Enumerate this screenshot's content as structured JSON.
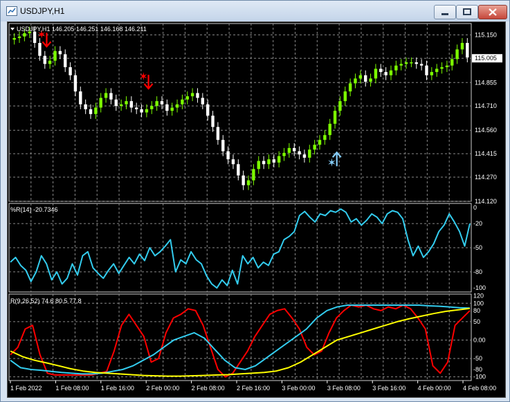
{
  "window": {
    "title": "USDJPY,H1"
  },
  "main_pane": {
    "header": "USDJPY,H1  146.205 146.251 146.168 146.211",
    "price_labels": [
      "115.150",
      "115.005",
      "114.855",
      "114.710",
      "114.560",
      "114.415",
      "114.270",
      "114.120"
    ],
    "current_price_label": "115.005"
  },
  "wpr_pane": {
    "header": "%R(14) -20.7346",
    "scale_labels": [
      "0",
      "-20",
      "-50",
      "-80",
      "-100"
    ]
  },
  "rsi_pane": {
    "header": "R(9,26,52) 74.6 80.5 77.8",
    "scale_labels": [
      "120",
      "100",
      "80",
      "50",
      "0.00",
      "-50",
      "-80",
      "-100"
    ]
  },
  "time_labels": [
    "1 Feb 2022",
    "1 Feb 08:00",
    "1 Feb 16:00",
    "2 Feb 00:00",
    "2 Feb 08:00",
    "2 Feb 16:00",
    "3 Feb 00:00",
    "3 Feb 08:00",
    "3 Feb 16:00",
    "4 Feb 00:00",
    "4 Feb 08:00"
  ],
  "colors": {
    "bull_candle": "#7cfc00",
    "bear_candle": "#ffffff",
    "sell_signal": "#ff0000",
    "buy_signal": "#87cefa",
    "wpr_line": "#33ccee",
    "rsi_fast": "#ff0000",
    "rsi_mid": "#33ccee",
    "rsi_slow": "#ffff00",
    "grid": "#8a8a8a"
  },
  "chart_data": [
    {
      "type": "candlestick",
      "symbol": "USDJPY",
      "timeframe": "H1",
      "ylim": [
        114.12,
        115.22
      ],
      "close": [
        115.13,
        115.14,
        115.16,
        115.17,
        115.1,
        115.02,
        114.97,
        114.99,
        115.05,
        115.03,
        114.95,
        114.9,
        114.8,
        114.72,
        114.69,
        114.66,
        114.7,
        114.76,
        114.79,
        114.75,
        114.71,
        114.72,
        114.74,
        114.7,
        114.69,
        114.67,
        114.69,
        114.71,
        114.74,
        114.72,
        114.68,
        114.7,
        114.72,
        114.75,
        114.77,
        114.79,
        114.76,
        114.72,
        114.65,
        114.58,
        114.5,
        114.43,
        114.38,
        114.35,
        114.28,
        114.22,
        114.25,
        114.32,
        114.37,
        114.35,
        114.38,
        114.36,
        114.4,
        114.42,
        114.45,
        114.43,
        114.41,
        114.39,
        114.44,
        114.47,
        114.5,
        114.53,
        114.6,
        114.68,
        114.74,
        114.8,
        114.85,
        114.88,
        114.9,
        114.86,
        114.88,
        114.94,
        114.92,
        114.9,
        114.93,
        114.96,
        114.97,
        114.98,
        114.98,
        114.97,
        114.96,
        114.9,
        114.92,
        114.94,
        114.95,
        114.96,
        115.0,
        115.06,
        115.1,
        115.01
      ],
      "open": [
        115.12,
        115.13,
        115.14,
        115.16,
        115.17,
        115.1,
        115.02,
        114.97,
        114.99,
        115.05,
        115.03,
        114.95,
        114.9,
        114.8,
        114.72,
        114.69,
        114.66,
        114.7,
        114.76,
        114.79,
        114.75,
        114.71,
        114.72,
        114.74,
        114.7,
        114.69,
        114.67,
        114.69,
        114.71,
        114.74,
        114.72,
        114.68,
        114.7,
        114.72,
        114.75,
        114.77,
        114.79,
        114.76,
        114.72,
        114.65,
        114.58,
        114.5,
        114.43,
        114.38,
        114.35,
        114.28,
        114.22,
        114.25,
        114.32,
        114.37,
        114.35,
        114.38,
        114.36,
        114.4,
        114.42,
        114.45,
        114.43,
        114.41,
        114.39,
        114.44,
        114.47,
        114.5,
        114.53,
        114.6,
        114.68,
        114.74,
        114.8,
        114.85,
        114.88,
        114.9,
        114.86,
        114.88,
        114.94,
        114.92,
        114.9,
        114.93,
        114.96,
        114.97,
        114.98,
        114.98,
        114.97,
        114.96,
        114.9,
        114.92,
        114.94,
        114.95,
        114.96,
        115.0,
        115.06,
        115.1
      ],
      "signals": [
        {
          "type": "sell",
          "bar": 5,
          "price": 115.12
        },
        {
          "type": "sell",
          "bar": 25,
          "price": 114.86
        },
        {
          "type": "buy",
          "bar": 62,
          "price": 114.38
        }
      ]
    },
    {
      "type": "line",
      "name": "%R(14)",
      "ylim": [
        -105,
        5
      ],
      "y_ticks": [
        0,
        -20,
        -50,
        -80,
        -100
      ],
      "values": [
        -68,
        -62,
        -72,
        -78,
        -92,
        -80,
        -60,
        -70,
        -90,
        -80,
        -95,
        -88,
        -70,
        -84,
        -60,
        -55,
        -75,
        -82,
        -88,
        -78,
        -70,
        -82,
        -72,
        -62,
        -70,
        -58,
        -66,
        -50,
        -60,
        -55,
        -48,
        -40,
        -80,
        -65,
        -70,
        -55,
        -65,
        -70,
        -85,
        -95,
        -100,
        -90,
        -97,
        -78,
        -95,
        -60,
        -70,
        -62,
        -75,
        -68,
        -72,
        -58,
        -55,
        -40,
        -36,
        -30,
        -10,
        -5,
        -12,
        -18,
        -8,
        -10,
        -4,
        -6,
        -2,
        -6,
        -18,
        -14,
        -22,
        -16,
        -8,
        -12,
        -20,
        -8,
        -4,
        -6,
        -14,
        -40,
        -60,
        -48,
        -62,
        -55,
        -45,
        -30,
        -22,
        -8,
        -18,
        -30,
        -48,
        -20
      ]
    },
    {
      "type": "line",
      "name": "R(9,26,52)",
      "ylim": [
        -110,
        125
      ],
      "y_ticks": [
        120,
        100,
        80,
        50,
        0,
        -50,
        -80,
        -100
      ],
      "series": [
        {
          "values": [
            -40,
            -20,
            30,
            40,
            -40,
            -90,
            -95,
            -95,
            -95,
            -95,
            -95,
            -95,
            -90,
            -85,
            -30,
            40,
            70,
            40,
            10,
            -60,
            -50,
            20,
            60,
            70,
            85,
            80,
            40,
            -20,
            -80,
            -100,
            -90,
            -60,
            -30,
            10,
            40,
            70,
            80,
            85,
            60,
            30,
            -20,
            -40,
            -30,
            20,
            60,
            80,
            95,
            90,
            95,
            85,
            80,
            90,
            85,
            95,
            85,
            60,
            30,
            -70,
            -90,
            -60,
            40,
            60,
            80
          ]
        },
        {
          "values": [
            -55,
            -75,
            -80,
            -82,
            -85,
            -88,
            -90,
            -92,
            -92,
            -90,
            -85,
            -80,
            -70,
            -55,
            -40,
            -20,
            0,
            10,
            20,
            5,
            -25,
            -55,
            -75,
            -80,
            -70,
            -50,
            -30,
            -10,
            10,
            30,
            60,
            80,
            90,
            95,
            95,
            95,
            95,
            95,
            95,
            95,
            95,
            93,
            92,
            90,
            88,
            87
          ]
        },
        {
          "values": [
            -30,
            -45,
            -55,
            -62,
            -70,
            -78,
            -84,
            -88,
            -90,
            -92,
            -94,
            -96,
            -97,
            -98,
            -98,
            -97,
            -96,
            -95,
            -94,
            -92,
            -90,
            -88,
            -84,
            -75,
            -60,
            -40,
            -20,
            0,
            10,
            20,
            30,
            40,
            50,
            58,
            65,
            72,
            78,
            82,
            86
          ]
        }
      ]
    }
  ]
}
